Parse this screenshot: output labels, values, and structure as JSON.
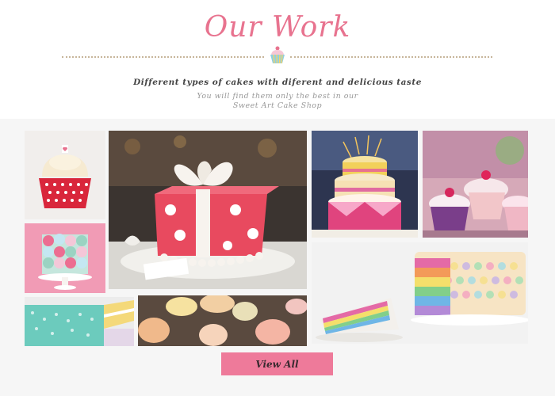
{
  "section": {
    "title": "Our Work",
    "tagline": "Different types of cakes with diferent and delicious taste",
    "line2": "You will find them only the best in our",
    "line3": "Sweet Art Cake Shop"
  },
  "gallery": {
    "items": [
      {
        "icon": "cupcake-heart-photo"
      },
      {
        "icon": "gift-cake-photo"
      },
      {
        "icon": "tiered-party-cake-photo"
      },
      {
        "icon": "cupcakes-pastel-photo"
      },
      {
        "icon": "rosette-cake-photo"
      },
      {
        "icon": "rainbow-layer-cake-photo"
      },
      {
        "icon": "teal-cake-slice-photo"
      },
      {
        "icon": "frosted-cupcakes-photo"
      }
    ]
  },
  "actions": {
    "view_all_label": "View All"
  },
  "colors": {
    "accent": "#e8738f",
    "button": "#ee7a9a"
  }
}
